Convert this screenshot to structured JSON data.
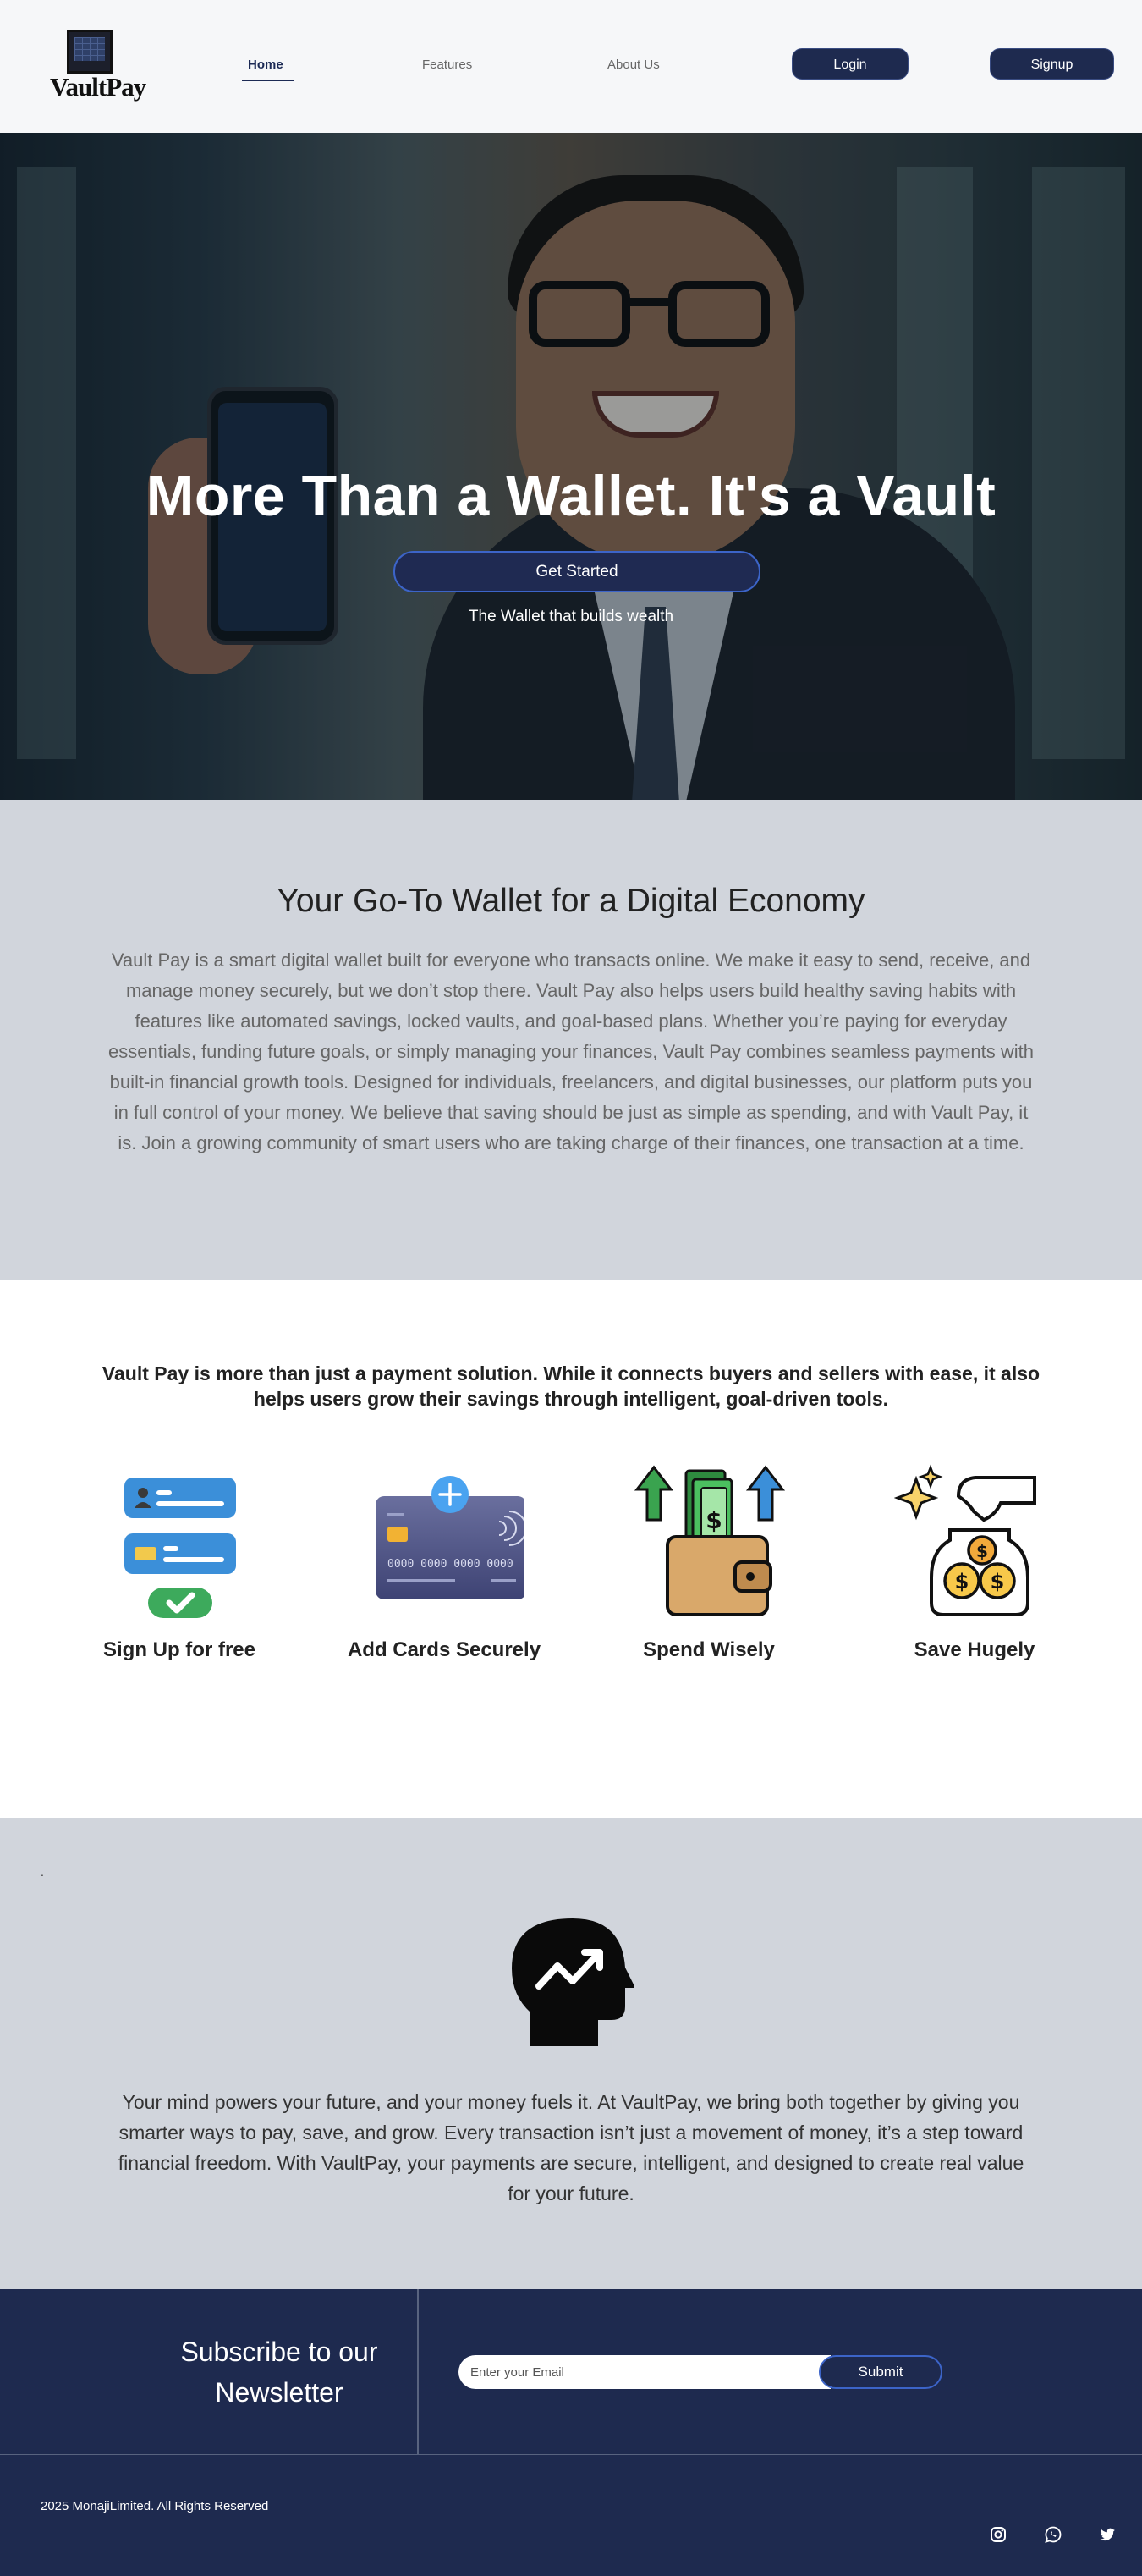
{
  "nav": {
    "logo_text": "VaultPay",
    "links": [
      {
        "label": "Home",
        "active": true
      },
      {
        "label": "Features",
        "active": false
      },
      {
        "label": "About Us",
        "active": false
      }
    ],
    "login_label": "Login",
    "signup_label": "Signup"
  },
  "hero": {
    "title": "More Than a Wallet. It's a Vault",
    "cta_label": "Get Started",
    "subtitle": "The Wallet that builds wealth"
  },
  "about": {
    "heading": "Your Go-To Wallet for a Digital Economy",
    "body": "Vault Pay is a smart digital wallet built for everyone who transacts online. We make it easy to send, receive, and manage money securely, but we don’t stop there. Vault Pay also helps users build healthy saving habits with features like automated savings, locked vaults, and goal-based plans. Whether you’re paying for everyday essentials, funding future goals, or simply managing your finances, Vault Pay combines seamless payments with built-in financial growth tools. Designed for individuals, freelancers, and digital businesses, our platform puts you in full control of your money. We believe that saving should be just as simple as spending, and with Vault Pay, it is. Join a growing community of smart users who are taking charge of their finances, one transaction at a time."
  },
  "features": {
    "intro": "Vault Pay is more than just a payment solution. While it connects buyers and sellers with ease, it also helps users grow their savings through intelligent, goal-driven tools.",
    "items": [
      {
        "label": "Sign Up for free",
        "icon": "signup-form-icon"
      },
      {
        "label": "Add Cards Securely",
        "icon": "credit-card-icon"
      },
      {
        "label": "Spend Wisely",
        "icon": "wallet-cash-icon"
      },
      {
        "label": "Save Hugely",
        "icon": "savings-jar-icon"
      }
    ],
    "card_number": "0000 0000 0000 0000"
  },
  "mind": {
    "marker": ".",
    "icon": "head-growth-icon",
    "body": "Your mind powers your future, and your money fuels it. At VaultPay, we bring both together by giving you smarter ways to pay, save, and grow. Every transaction isn’t just a movement of money, it’s a step toward financial freedom. With VaultPay, your payments are secure, intelligent, and designed to create real value for your future."
  },
  "newsletter": {
    "title": "Subscribe to our Newsletter",
    "email_placeholder": "Enter your Email",
    "submit_label": "Submit"
  },
  "footer": {
    "copyright": "2025 MonajiLimited. All Rights Reserved",
    "social_icons": [
      "instagram-icon",
      "whatsapp-icon",
      "twitter-icon"
    ]
  },
  "colors": {
    "brand_navy": "#1e2a4f",
    "accent_blue": "#3c64c8",
    "section_gray": "#d1d5dc"
  }
}
